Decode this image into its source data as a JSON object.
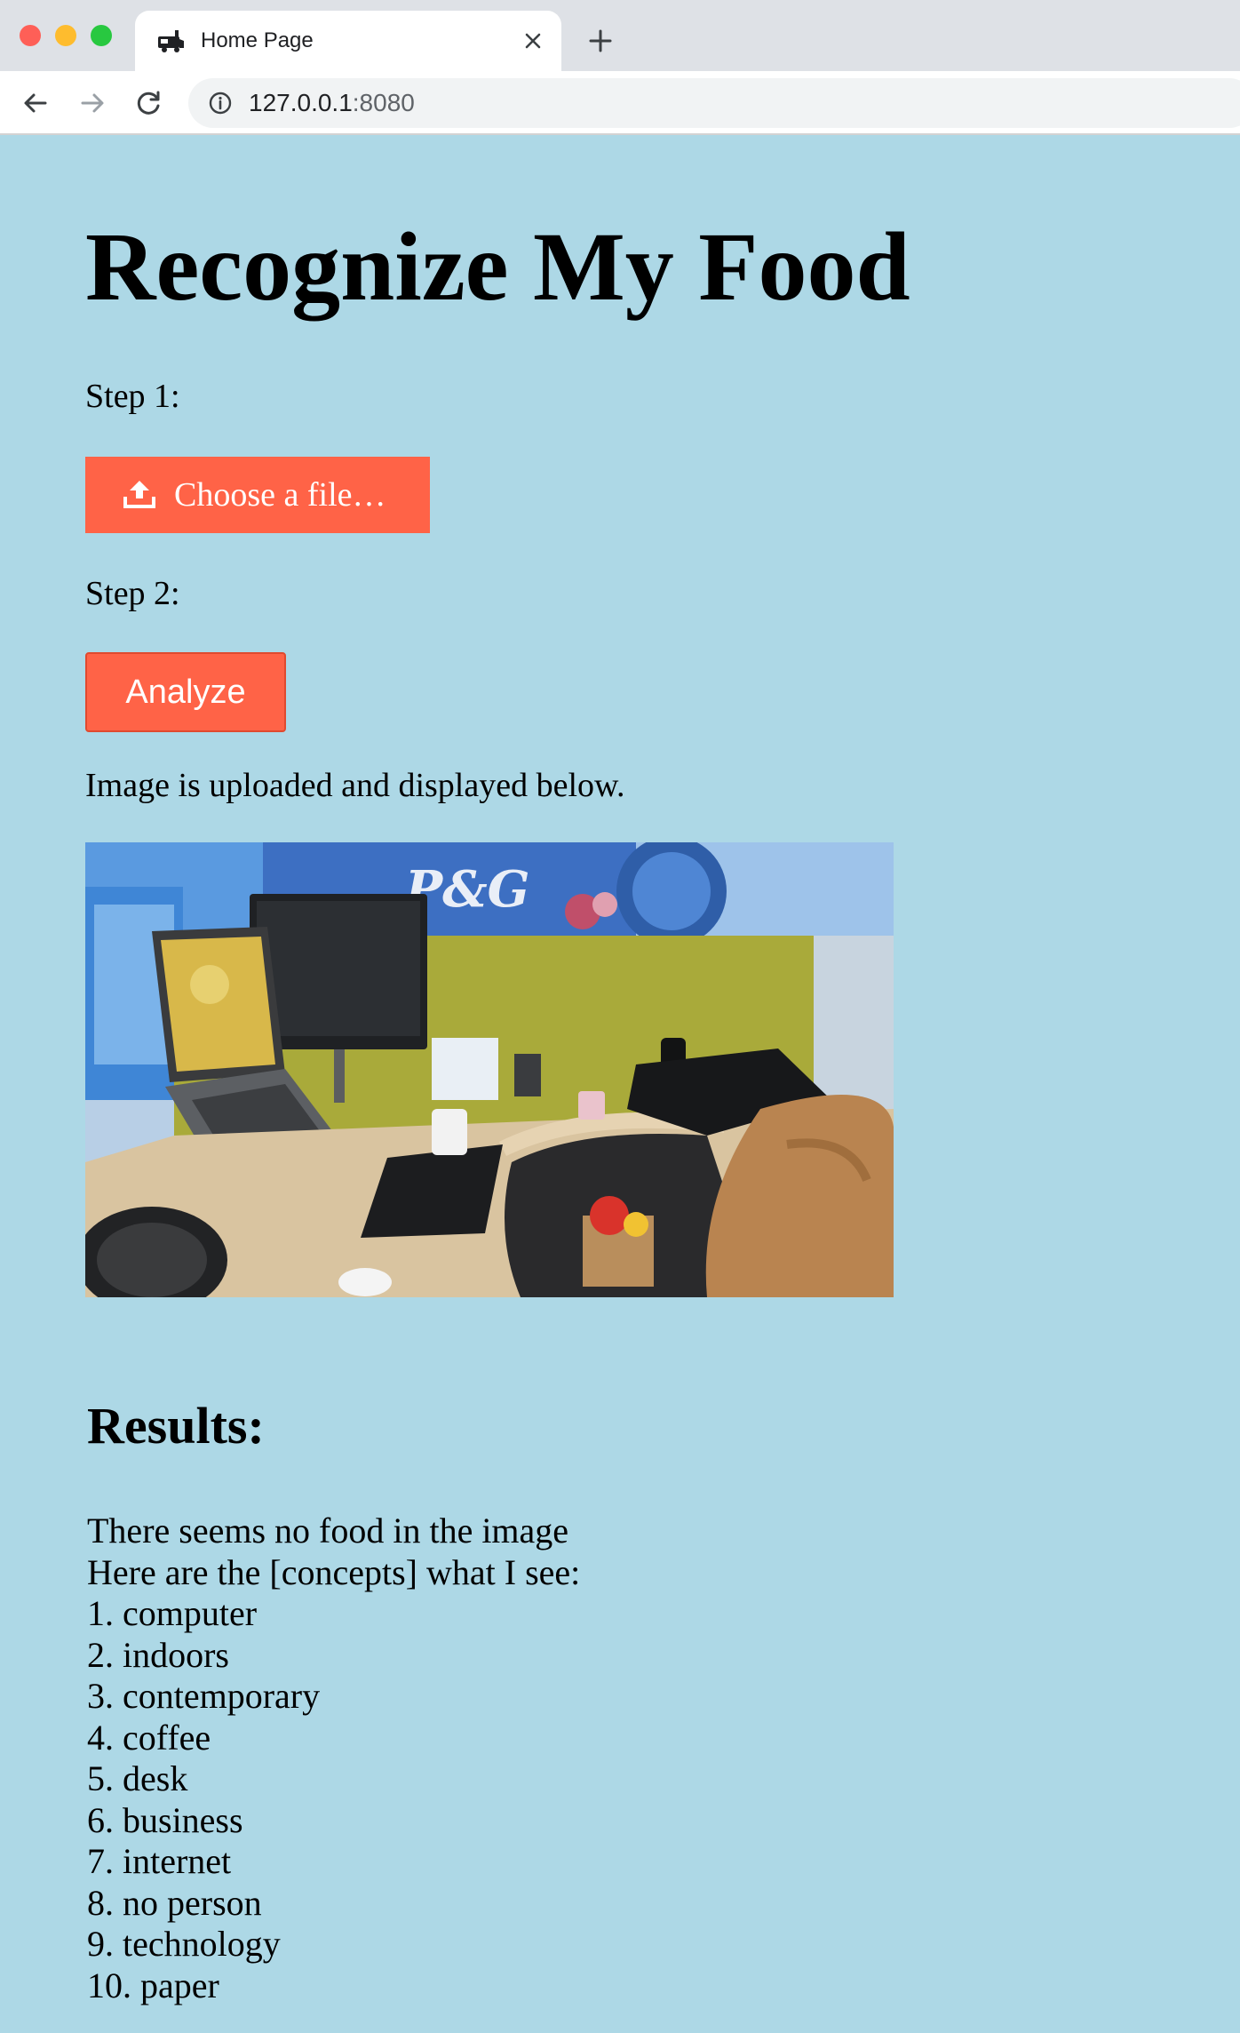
{
  "browser": {
    "tab_title": "Home Page",
    "url_host": "127.0.0.1",
    "url_port": ":8080",
    "favicon": "food-truck-icon"
  },
  "page": {
    "title": "Recognize My Food",
    "step1_label": "Step 1:",
    "upload_label": "Choose a file…",
    "step2_label": "Step 2:",
    "analyze_label": "Analyze",
    "status": "Image is uploaded and displayed below."
  },
  "results": {
    "heading": "Results:",
    "line1": "There seems no food in the image",
    "line2": "Here are the [concepts] what I see:",
    "concepts": [
      "1. computer",
      "2. indoors",
      "3. contemporary",
      "4. coffee",
      "5. desk",
      "6. business",
      "7. internet",
      "8. no person",
      "9. technology",
      "10. paper"
    ]
  },
  "colors": {
    "page_background": "#add8e6",
    "button": "#ff6347",
    "button_text": "#ffffff"
  }
}
